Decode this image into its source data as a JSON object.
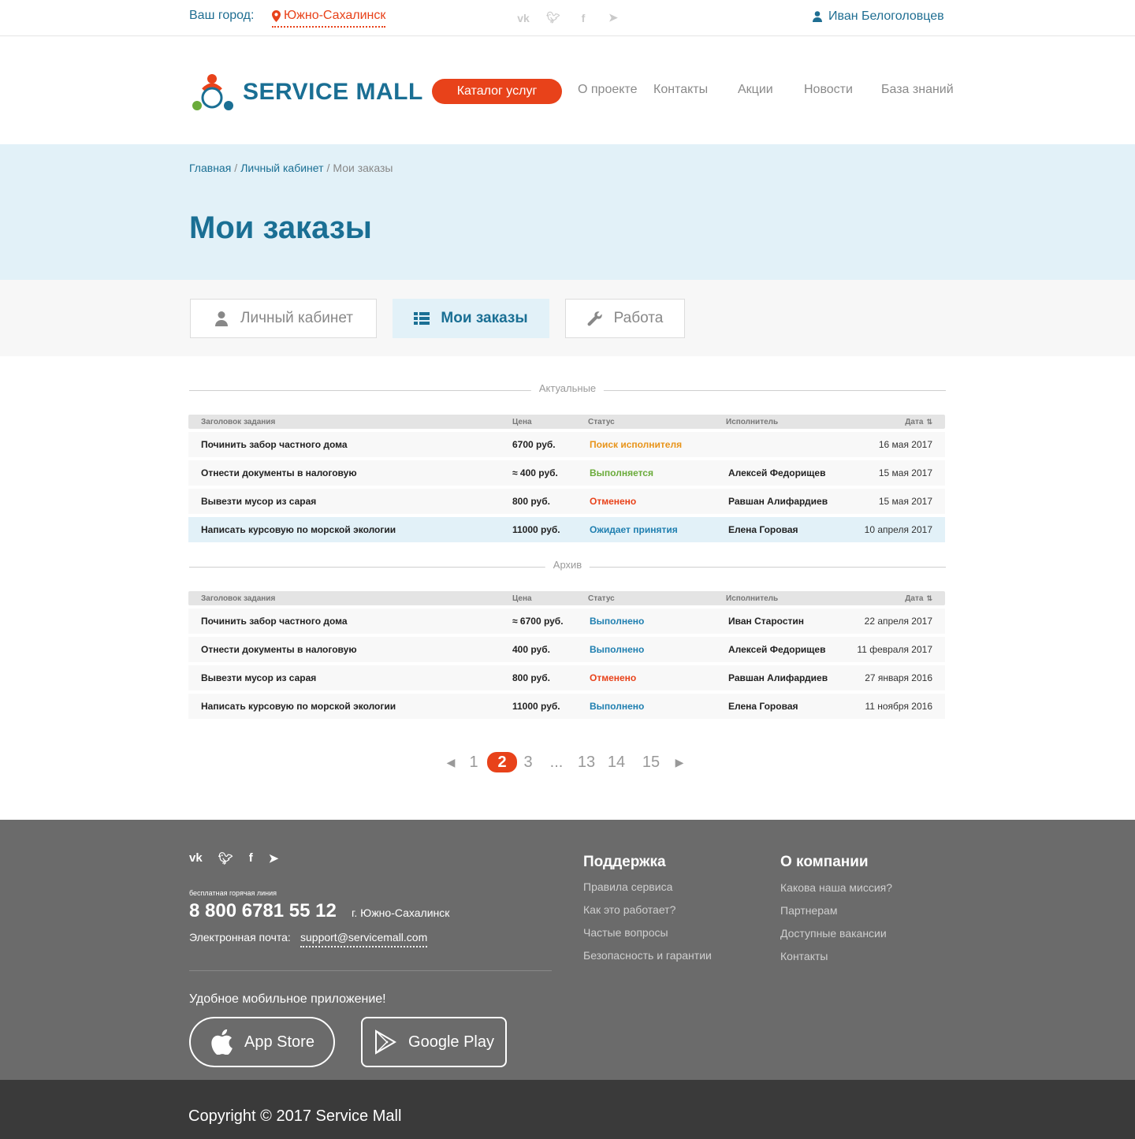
{
  "topbar": {
    "city_label": "Ваш город:",
    "city": "Южно-Сахалинск",
    "social": [
      "vk-icon",
      "twitter-icon",
      "facebook-icon",
      "telegram-icon"
    ],
    "user_name": "Иван Белоголовцев"
  },
  "header": {
    "logo_text": "SERVICE MALL",
    "catalog_button": "Каталог услуг",
    "nav": [
      "О проекте",
      "Контакты",
      "Акции",
      "Новости",
      "База знаний"
    ]
  },
  "breadcrumb": {
    "home": "Главная",
    "cabinet": "Личный кабинет",
    "current": "Мои заказы"
  },
  "page_title": "Мои заказы",
  "tabs": [
    {
      "label": "Личный кабинет",
      "icon": "user-icon",
      "active": false
    },
    {
      "label": "Мои заказы",
      "icon": "list-icon",
      "active": true
    },
    {
      "label": "Работа",
      "icon": "wrench-icon",
      "active": false
    }
  ],
  "table_headers": {
    "title": "Заголовок задания",
    "price": "Цена",
    "status": "Статус",
    "executor": "Исполнитель",
    "date": "Дата"
  },
  "colors": {
    "accent": "#e8421a",
    "brand": "#1a6f94",
    "status_search": "#e8941a",
    "status_progress": "#6aab3a",
    "status_cancelled": "#e8421a",
    "status_waiting": "#1f7fb0",
    "status_done": "#1f7fb0"
  },
  "current_section": {
    "label": "Актуальные",
    "rows": [
      {
        "title": "Починить забор частного дома",
        "price": "6700 руб.",
        "status": "Поиск исполнителя",
        "status_color": "#e8941a",
        "executor": "",
        "date": "16 мая 2017",
        "highlight": false
      },
      {
        "title": "Отнести документы в налоговую",
        "price": "≈ 400 руб.",
        "status": "Выполняется",
        "status_color": "#6aab3a",
        "executor": "Алексей Федорищев",
        "date": "15 мая 2017",
        "highlight": false
      },
      {
        "title": "Вывезти мусор из сарая",
        "price": "800 руб.",
        "status": "Отменено",
        "status_color": "#e8421a",
        "executor": "Равшан Алифардиев",
        "date": "15 мая 2017",
        "highlight": false
      },
      {
        "title": "Написать курсовую по морской экологии",
        "price": "11000 руб.",
        "status": "Ожидает принятия",
        "status_color": "#1f7fb0",
        "executor": "Елена Горовая",
        "date": "10 апреля 2017",
        "highlight": true
      }
    ]
  },
  "archive_section": {
    "label": "Архив",
    "rows": [
      {
        "title": "Починить забор частного дома",
        "price": "≈ 6700 руб.",
        "status": "Выполнено",
        "status_color": "#1f7fb0",
        "executor": "Иван Старостин",
        "date": "22 апреля 2017"
      },
      {
        "title": "Отнести документы в налоговую",
        "price": "400 руб.",
        "status": "Выполнено",
        "status_color": "#1f7fb0",
        "executor": "Алексей Федорищев",
        "date": "11 февраля 2017"
      },
      {
        "title": "Вывезти мусор из сарая",
        "price": "800 руб.",
        "status": "Отменено",
        "status_color": "#e8421a",
        "executor": "Равшан Алифардиев",
        "date": "27 января 2016"
      },
      {
        "title": "Написать курсовую по морской экологии",
        "price": "11000 руб.",
        "status": "Выполнено",
        "status_color": "#1f7fb0",
        "executor": "Елена Горовая",
        "date": "11 ноября 2016"
      }
    ]
  },
  "pagination": {
    "pages": [
      "1",
      "2",
      "3",
      "...",
      "13",
      "14",
      "15"
    ],
    "current": "2"
  },
  "footer": {
    "social": [
      "vk-icon",
      "twitter-icon",
      "facebook-icon",
      "telegram-icon"
    ],
    "hotline_label": "бесплатная  горячая линия",
    "phone": "8 800 6781 55 12",
    "city": "г. Южно-Сахалинск",
    "email_label": "Электронная почта:",
    "email": "support@servicemall.com",
    "app_label": "Удобное мобильное приложение!",
    "app_store": "App Store",
    "google_play": "Google Play",
    "support_title": "Поддержка",
    "support_links": [
      "Правила сервиса",
      "Как это работает?",
      "Частые вопросы",
      "Безопасность и гарантии"
    ],
    "company_title": "О компании",
    "company_links": [
      "Какова наша миссия?",
      "Партнерам",
      "Доступные вакансии",
      "Контакты"
    ]
  },
  "copyright": "Copyright © 2017 Service Mall"
}
